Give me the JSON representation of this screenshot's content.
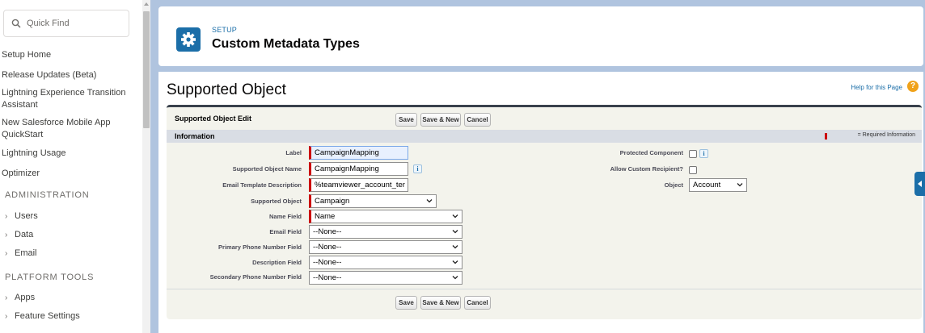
{
  "sidebar": {
    "quick_find_placeholder": "Quick Find",
    "items": [
      {
        "label": "Setup Home"
      },
      {
        "label": "Release Updates (Beta)"
      },
      {
        "label": "Lightning Experience Transition Assistant"
      },
      {
        "label": "New Salesforce Mobile App QuickStart"
      },
      {
        "label": "Lightning Usage"
      },
      {
        "label": "Optimizer"
      }
    ],
    "section_admin": "ADMINISTRATION",
    "admin_items": [
      {
        "label": "Users"
      },
      {
        "label": "Data"
      },
      {
        "label": "Email"
      }
    ],
    "section_platform": "PLATFORM TOOLS",
    "platform_items": [
      {
        "label": "Apps"
      },
      {
        "label": "Feature Settings"
      }
    ]
  },
  "header": {
    "setup_label": "SETUP",
    "title": "Custom Metadata Types"
  },
  "page": {
    "heading": "Supported Object",
    "help_link": "Help for this Page",
    "help_icon": "question-icon"
  },
  "edit": {
    "title": "Supported Object Edit",
    "save": "Save",
    "save_new": "Save & New",
    "cancel": "Cancel"
  },
  "info": {
    "section_title": "Information",
    "required_info": "= Required Information"
  },
  "fields": {
    "label": {
      "label": "Label",
      "value": "CampaignMapping"
    },
    "supported_object_name": {
      "label": "Supported Object Name",
      "value": "CampaignMapping"
    },
    "email_template_description": {
      "label": "Email Template Description",
      "value": "%teamviewer_account_ter"
    },
    "supported_object": {
      "label": "Supported Object",
      "value": "Campaign"
    },
    "name_field": {
      "label": "Name Field",
      "value": "Name"
    },
    "email_field": {
      "label": "Email Field",
      "value": "--None--"
    },
    "primary_phone_field": {
      "label": "Primary Phone Number Field",
      "value": "--None--"
    },
    "description_field": {
      "label": "Description Field",
      "value": "--None--"
    },
    "secondary_phone_field": {
      "label": "Secondary Phone Number Field",
      "value": "--None--"
    },
    "protected_component": {
      "label": "Protected Component",
      "checked": false
    },
    "allow_custom_recipient": {
      "label": "Allow Custom Recipient?",
      "checked": false
    },
    "object": {
      "label": "Object",
      "value": "Account"
    }
  },
  "colors": {
    "brand": "#1b6ea8",
    "required": "#cc0000",
    "page_bg": "#b0c4df"
  }
}
